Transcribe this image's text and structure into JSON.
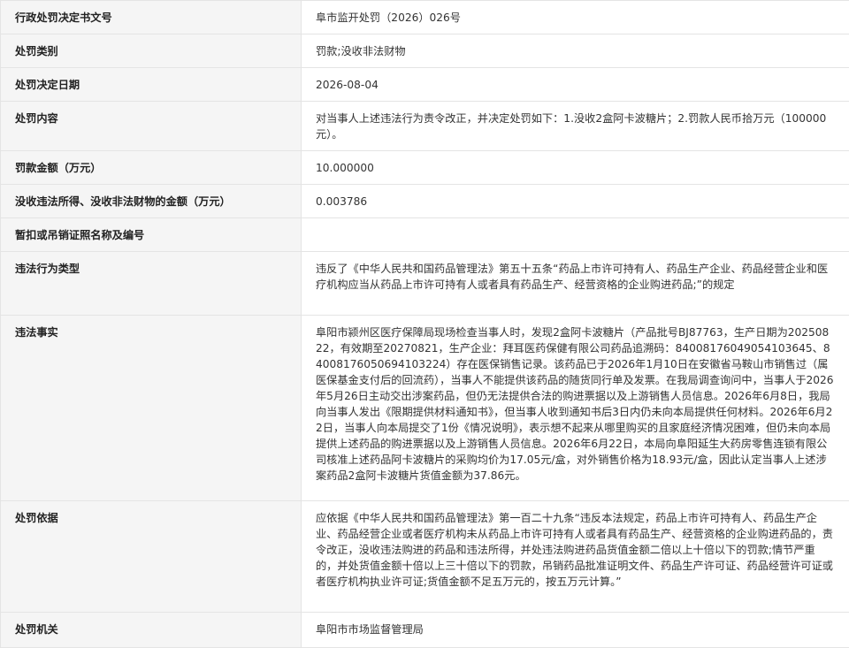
{
  "rows": [
    {
      "label": "行政处罚决定书文号",
      "value": "阜市监开处罚（2026）026号"
    },
    {
      "label": "处罚类别",
      "value": "罚款;没收非法财物"
    },
    {
      "label": "处罚决定日期",
      "value": "2026-08-04"
    },
    {
      "label": "处罚内容",
      "value": "对当事人上述违法行为责令改正，并决定处罚如下：1.没收2盒阿卡波糖片；2.罚款人民币拾万元（100000元）。"
    },
    {
      "label": "罚款金额（万元）",
      "value": "10.000000"
    },
    {
      "label": "没收违法所得、没收非法财物的金额（万元）",
      "value": "0.003786"
    },
    {
      "label": "暂扣或吊销证照名称及编号",
      "value": ""
    },
    {
      "label": "违法行为类型",
      "value": "违反了《中华人民共和国药品管理法》第五十五条“药品上市许可持有人、药品生产企业、药品经营企业和医疗机构应当从药品上市许可持有人或者具有药品生产、经营资格的企业购进药品;”的规定"
    },
    {
      "label": "违法事实",
      "value": "阜阳市颍州区医疗保障局现场检查当事人时，发现2盒阿卡波糖片（产品批号BJ87763，生产日期为20250822，有效期至20270821，生产企业：拜耳医药保健有限公司药品追溯码：84008176049054103645、84008176050694103224）存在医保销售记录。该药品已于2026年1月10日在安徽省马鞍山市销售过（属医保基金支付后的回流药），当事人不能提供该药品的随货同行单及发票。在我局调查询问中，当事人于2026年5月26日主动交出涉案药品，但仍无法提供合法的购进票据以及上游销售人员信息。2026年6月8日，我局向当事人发出《限期提供材料通知书》，但当事人收到通知书后3日内仍未向本局提供任何材料。2026年6月22日，当事人向本局提交了1份《情况说明》，表示想不起来从哪里购买的且家庭经济情况困难，但仍未向本局提供上述药品的购进票据以及上游销售人员信息。2026年6月22日，本局向阜阳延生大药房零售连锁有限公司核准上述药品阿卡波糖片的采购均价为17.05元/盒，对外销售价格为18.93元/盒，因此认定当事人上述涉案药品2盒阿卡波糖片货值金额为37.86元。"
    },
    {
      "label": "处罚依据",
      "value": "应依据《中华人民共和国药品管理法》第一百二十九条“违反本法规定，药品上市许可持有人、药品生产企业、药品经营企业或者医疗机构未从药品上市许可持有人或者具有药品生产、经营资格的企业购进药品的，责令改正，没收违法购进的药品和违法所得，并处违法购进药品货值金额二倍以上十倍以下的罚款;情节严重的，并处货值金额十倍以上三十倍以下的罚款，吊销药品批准证明文件、药品生产许可证、药品经营许可证或者医疗机构执业许可证;货值金额不足五万元的，按五万元计算。”"
    },
    {
      "label": "处罚机关",
      "value": "阜阳市市场监督管理局"
    }
  ]
}
